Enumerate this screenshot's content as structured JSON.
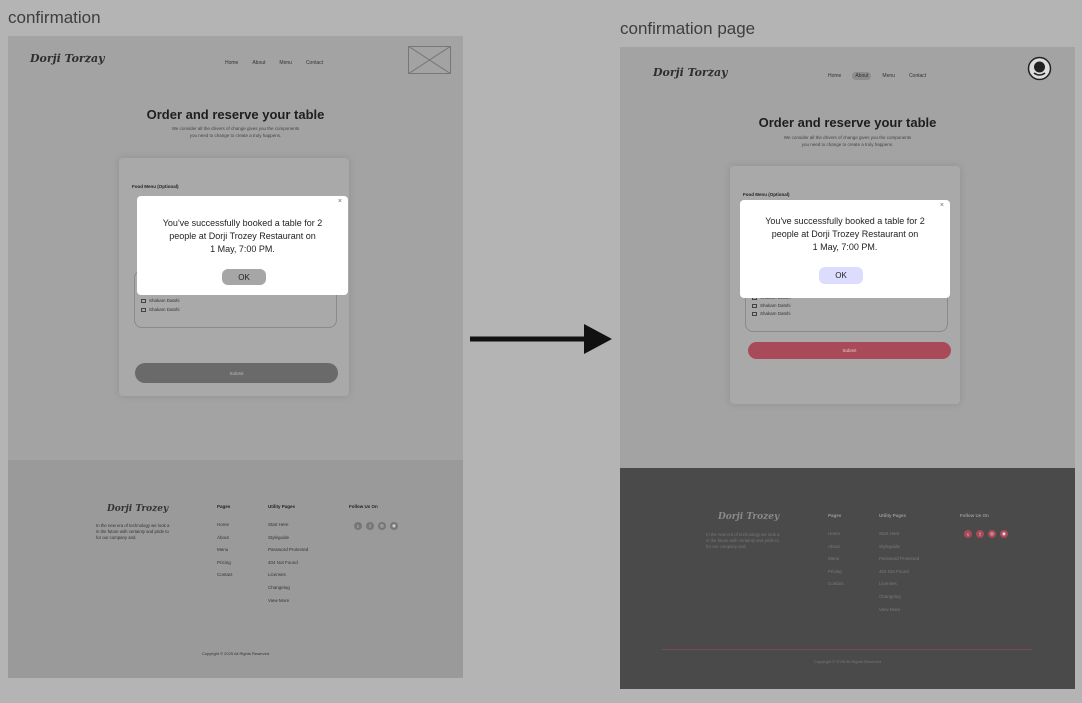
{
  "boards": {
    "left_title": "confirmation",
    "right_title": "confirmation page"
  },
  "site": {
    "logo": "Dorji Torzay",
    "nav": [
      "Home",
      "About",
      "Menu",
      "Contact"
    ],
    "active_nav_right": "About",
    "hero_title": "Order and reserve your table",
    "hero_sub_line1": "We consider all the drivers of change gives you the components",
    "hero_sub_line2": "you need to change to create a truly happens.",
    "food_menu_label": "Food Menu (Optional)",
    "menu_items": [
      "Shakam Datshi",
      "Shakam Datshi",
      "Shakam Datshi"
    ],
    "submit_label": "Submit"
  },
  "modal": {
    "line1": "You've successfully booked a table for 2",
    "line2": "people at Dorji Trozey Restaurant on",
    "line3": "1 May, 7:00 PM.",
    "ok_label": "OK",
    "close_symbol": "×"
  },
  "footer": {
    "logo": "Dorji Trozey",
    "desc_line1": "In the new era of technology we look a",
    "desc_line2": "in the future with certainty and pride to",
    "desc_line3": "for our company and.",
    "pages_heading": "Pages",
    "pages": [
      "Home",
      "About",
      "Menu",
      "Pricing",
      "Contact"
    ],
    "utility_heading": "Utility Pages",
    "utility": [
      "Start Here",
      "Styleguide",
      "Password Protected",
      "404 Not Found",
      "Licenses",
      "Changelog",
      "View More"
    ],
    "follow_heading": "Follow Us On",
    "social_icons": [
      "twitter-icon",
      "facebook-icon",
      "instagram-icon",
      "github-icon"
    ],
    "copyright": "Copyright © 2025 All Rights Reserved"
  },
  "colors": {
    "accent_right": "#a94a58",
    "ok_right": "#dcdcff",
    "footer_right": "#4a4a4a",
    "footer_left": "#9a9a9a"
  }
}
